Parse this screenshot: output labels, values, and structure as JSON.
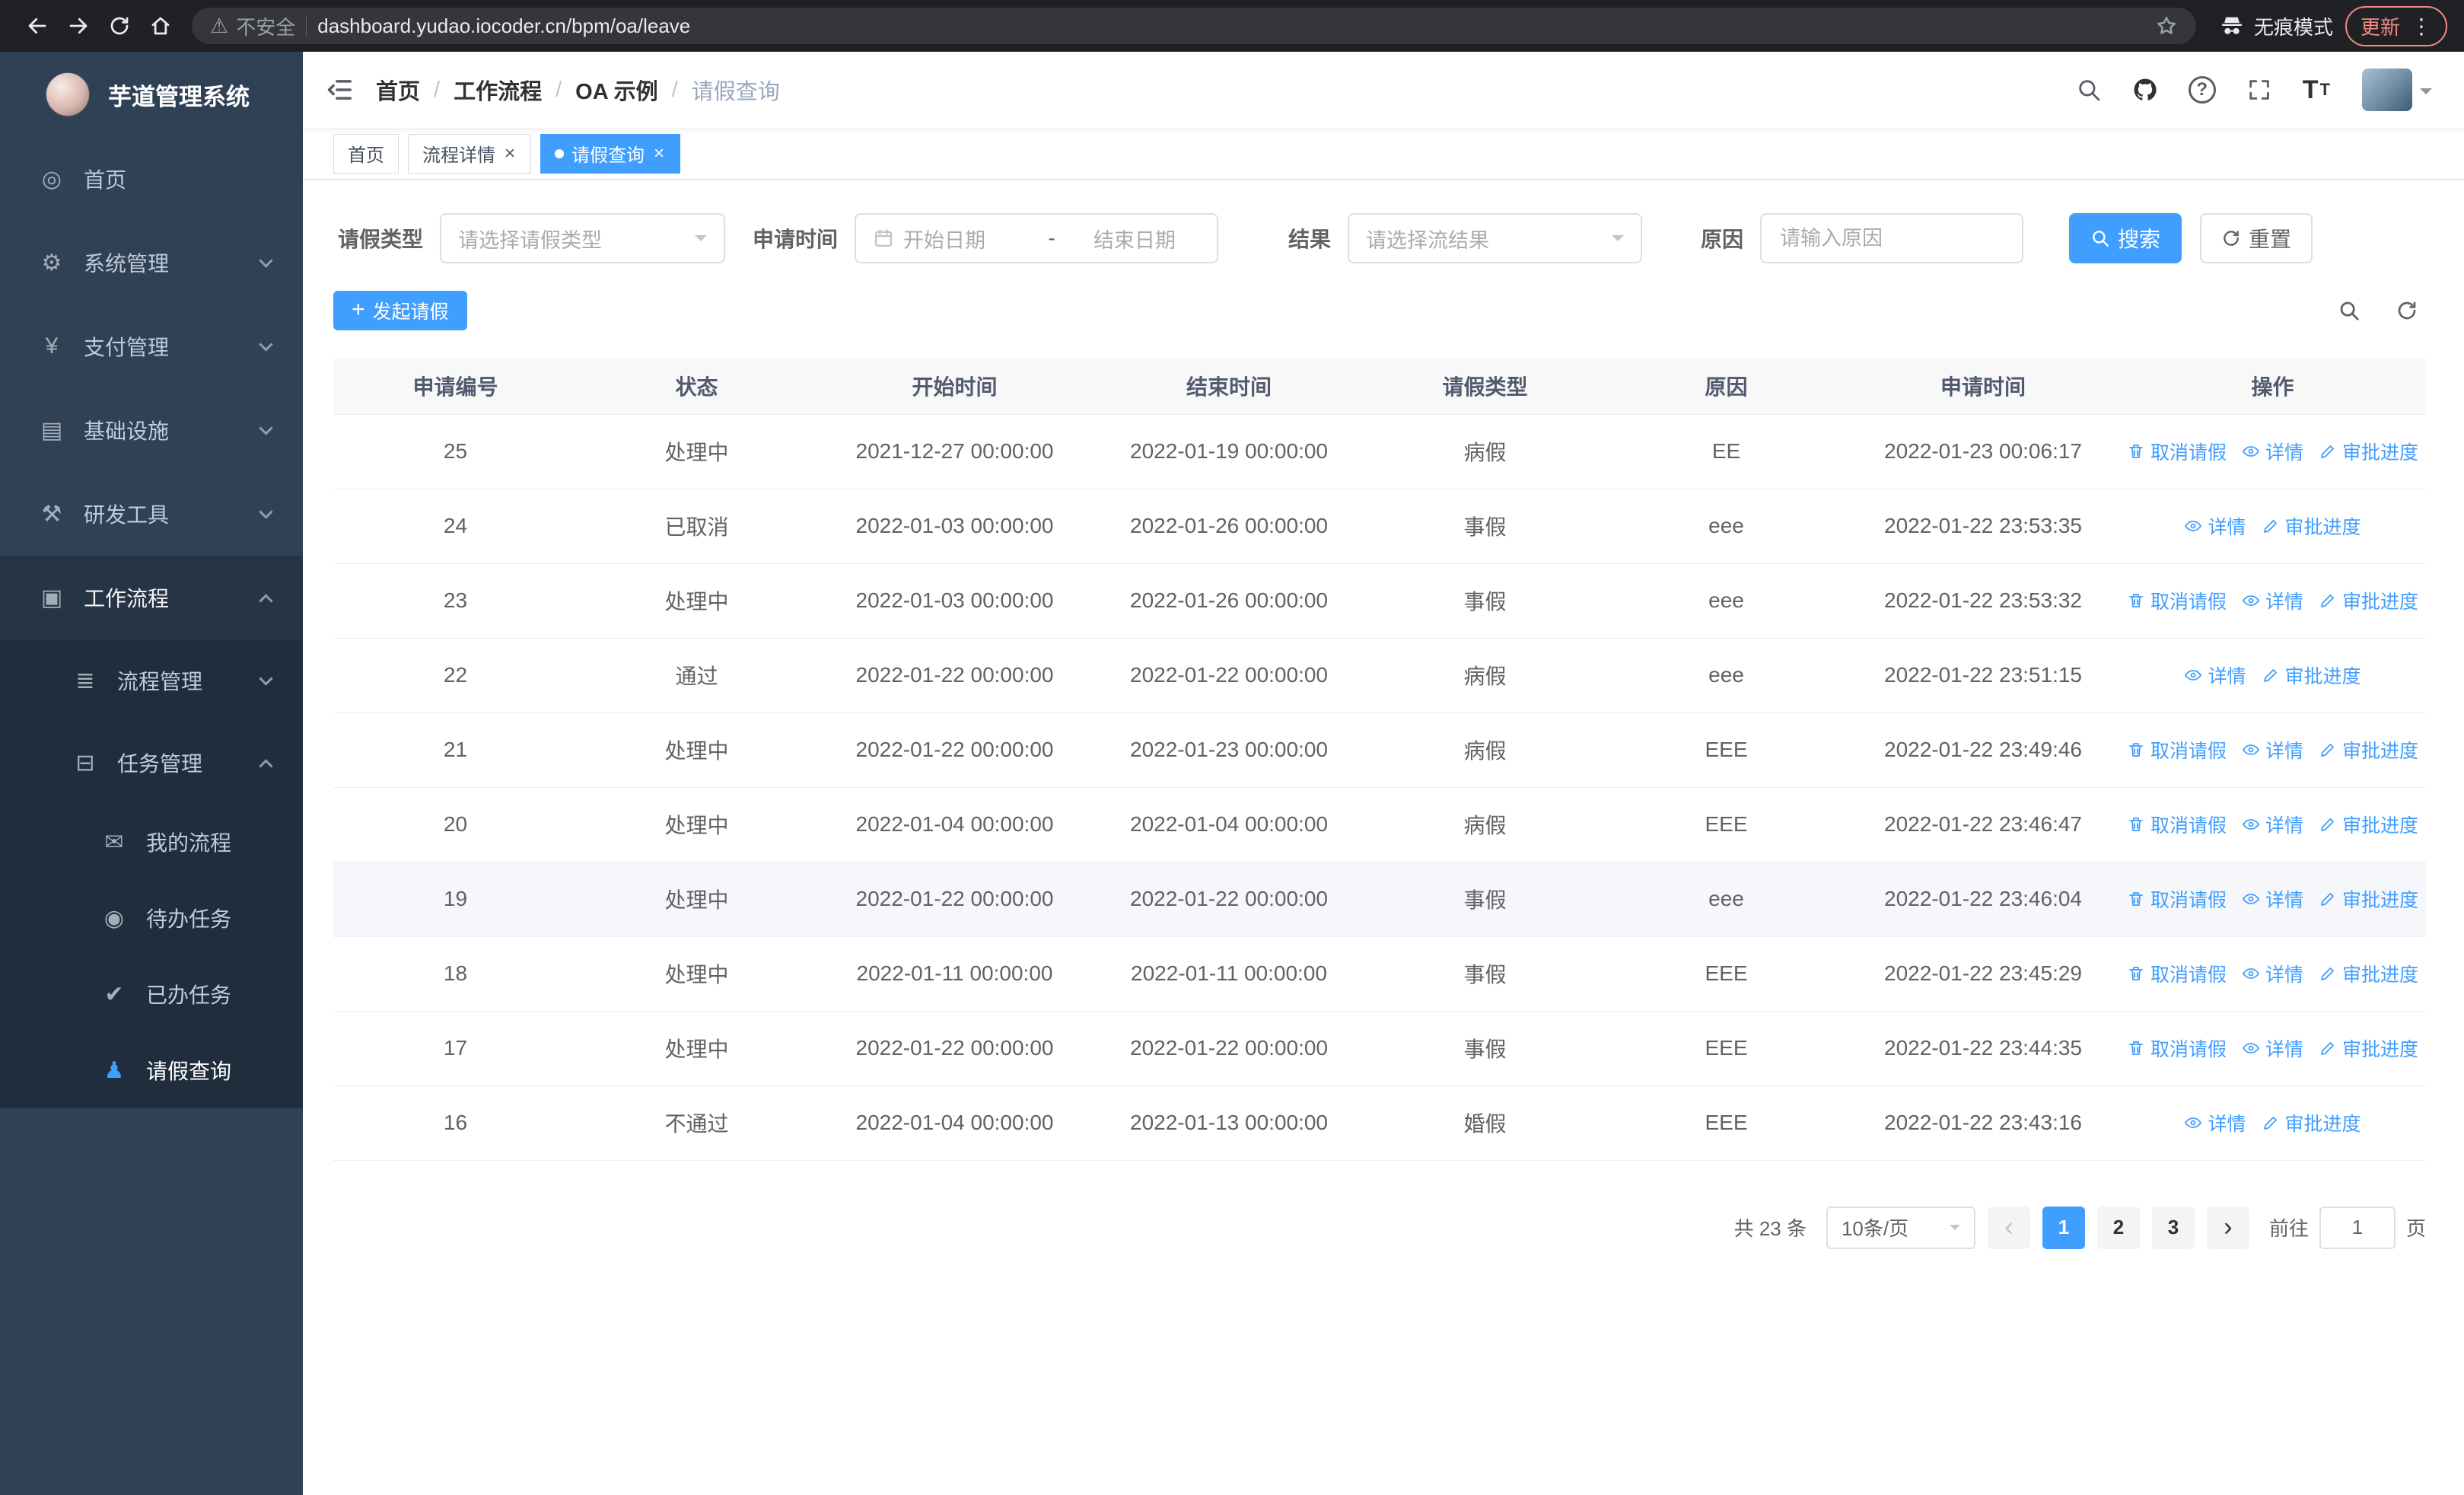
{
  "browser": {
    "security_label": "不安全",
    "url": "dashboard.yudao.iocoder.cn/bpm/oa/leave",
    "incognito_label": "无痕模式",
    "update_label": "更新"
  },
  "sidebar": {
    "logo_title": "芋道管理系统",
    "items": [
      {
        "key": "home",
        "label": "首页",
        "icon": "dashboard-icon",
        "expandable": false,
        "expanded": false
      },
      {
        "key": "system",
        "label": "系统管理",
        "icon": "gear-icon",
        "expandable": true,
        "expanded": false
      },
      {
        "key": "payment",
        "label": "支付管理",
        "icon": "yen-icon",
        "expandable": true,
        "expanded": false
      },
      {
        "key": "infrastructure",
        "label": "基础设施",
        "icon": "infra-icon",
        "expandable": true,
        "expanded": false
      },
      {
        "key": "devtools",
        "label": "研发工具",
        "icon": "tools-icon",
        "expandable": true,
        "expanded": false
      },
      {
        "key": "workflow",
        "label": "工作流程",
        "icon": "workflow-icon",
        "expandable": true,
        "expanded": true
      }
    ],
    "workflow_children": [
      {
        "key": "process-mgmt",
        "label": "流程管理",
        "icon": "process-icon",
        "level": 2,
        "expandable": true,
        "expanded": false,
        "active": false
      },
      {
        "key": "task-mgmt",
        "label": "任务管理",
        "icon": "tasks-icon",
        "level": 2,
        "expandable": true,
        "expanded": true,
        "active": false
      },
      {
        "key": "my-process",
        "label": "我的流程",
        "icon": "chat-icon",
        "level": 3,
        "expandable": false,
        "active": false
      },
      {
        "key": "todo-task",
        "label": "待办任务",
        "icon": "eye-icon",
        "level": 3,
        "expandable": false,
        "active": false
      },
      {
        "key": "done-task",
        "label": "已办任务",
        "icon": "check-icon",
        "level": 3,
        "expandable": false,
        "active": false
      },
      {
        "key": "leave-query",
        "label": "请假查询",
        "icon": "user-icon",
        "level": 3,
        "expandable": false,
        "active": true
      }
    ]
  },
  "header": {
    "breadcrumbs": [
      "首页",
      "工作流程",
      "OA 示例",
      "请假查询"
    ]
  },
  "tabs": [
    {
      "key": "home",
      "label": "首页",
      "closable": false,
      "active": false
    },
    {
      "key": "process-detail",
      "label": "流程详情",
      "closable": true,
      "active": false
    },
    {
      "key": "leave-query",
      "label": "请假查询",
      "closable": true,
      "active": true
    }
  ],
  "filters": {
    "leave_type_label": "请假类型",
    "leave_type_placeholder": "请选择请假类型",
    "apply_time_label": "申请时间",
    "start_date_placeholder": "开始日期",
    "range_separator": "-",
    "end_date_placeholder": "结束日期",
    "result_label": "结果",
    "result_placeholder": "请选择流结果",
    "reason_label": "原因",
    "reason_placeholder": "请输入原因",
    "search_label": "搜索",
    "reset_label": "重置"
  },
  "toolbar": {
    "create_label": "发起请假"
  },
  "table": {
    "columns": [
      "申请编号",
      "状态",
      "开始时间",
      "结束时间",
      "请假类型",
      "原因",
      "申请时间",
      "操作"
    ],
    "action_labels": {
      "cancel": "取消请假",
      "detail": "详情",
      "progress": "审批进度"
    },
    "rows": [
      {
        "id": "25",
        "status": "处理中",
        "start": "2021-12-27 00:00:00",
        "end": "2022-01-19 00:00:00",
        "type": "病假",
        "reason": "EE",
        "applied": "2022-01-23 00:06:17",
        "actions": [
          "cancel",
          "detail",
          "progress"
        ],
        "highlighted": false
      },
      {
        "id": "24",
        "status": "已取消",
        "start": "2022-01-03 00:00:00",
        "end": "2022-01-26 00:00:00",
        "type": "事假",
        "reason": "eee",
        "applied": "2022-01-22 23:53:35",
        "actions": [
          "detail",
          "progress"
        ],
        "highlighted": false
      },
      {
        "id": "23",
        "status": "处理中",
        "start": "2022-01-03 00:00:00",
        "end": "2022-01-26 00:00:00",
        "type": "事假",
        "reason": "eee",
        "applied": "2022-01-22 23:53:32",
        "actions": [
          "cancel",
          "detail",
          "progress"
        ],
        "highlighted": false
      },
      {
        "id": "22",
        "status": "通过",
        "start": "2022-01-22 00:00:00",
        "end": "2022-01-22 00:00:00",
        "type": "病假",
        "reason": "eee",
        "applied": "2022-01-22 23:51:15",
        "actions": [
          "detail",
          "progress"
        ],
        "highlighted": false
      },
      {
        "id": "21",
        "status": "处理中",
        "start": "2022-01-22 00:00:00",
        "end": "2022-01-23 00:00:00",
        "type": "病假",
        "reason": "EEE",
        "applied": "2022-01-22 23:49:46",
        "actions": [
          "cancel",
          "detail",
          "progress"
        ],
        "highlighted": false
      },
      {
        "id": "20",
        "status": "处理中",
        "start": "2022-01-04 00:00:00",
        "end": "2022-01-04 00:00:00",
        "type": "病假",
        "reason": "EEE",
        "applied": "2022-01-22 23:46:47",
        "actions": [
          "cancel",
          "detail",
          "progress"
        ],
        "highlighted": false
      },
      {
        "id": "19",
        "status": "处理中",
        "start": "2022-01-22 00:00:00",
        "end": "2022-01-22 00:00:00",
        "type": "事假",
        "reason": "eee",
        "applied": "2022-01-22 23:46:04",
        "actions": [
          "cancel",
          "detail",
          "progress"
        ],
        "highlighted": true
      },
      {
        "id": "18",
        "status": "处理中",
        "start": "2022-01-11 00:00:00",
        "end": "2022-01-11 00:00:00",
        "type": "事假",
        "reason": "EEE",
        "applied": "2022-01-22 23:45:29",
        "actions": [
          "cancel",
          "detail",
          "progress"
        ],
        "highlighted": false
      },
      {
        "id": "17",
        "status": "处理中",
        "start": "2022-01-22 00:00:00",
        "end": "2022-01-22 00:00:00",
        "type": "事假",
        "reason": "EEE",
        "applied": "2022-01-22 23:44:35",
        "actions": [
          "cancel",
          "detail",
          "progress"
        ],
        "highlighted": false
      },
      {
        "id": "16",
        "status": "不通过",
        "start": "2022-01-04 00:00:00",
        "end": "2022-01-13 00:00:00",
        "type": "婚假",
        "reason": "EEE",
        "applied": "2022-01-22 23:43:16",
        "actions": [
          "detail",
          "progress"
        ],
        "highlighted": false
      }
    ]
  },
  "pagination": {
    "total_text": "共 23 条",
    "page_size": "10条/页",
    "pages": [
      "1",
      "2",
      "3"
    ],
    "active_page": "1",
    "goto_prefix": "前往",
    "goto_value": "1",
    "goto_suffix": "页"
  }
}
